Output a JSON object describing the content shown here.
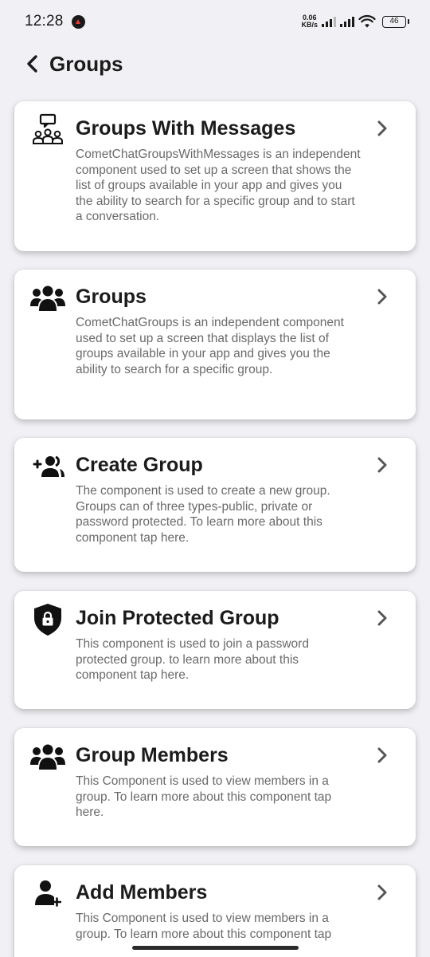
{
  "status": {
    "time": "12:28",
    "net_speed_value": "0.06",
    "net_speed_unit": "KB/s",
    "battery": "46"
  },
  "header": {
    "title": "Groups",
    "back_icon": "chevron-left-icon"
  },
  "cards": [
    {
      "title": "Groups With Messages",
      "description": "CometChatGroupsWithMessages is an independent component used to set up a screen that shows the list of groups available in your app and gives you the ability to search for a specific group and to start a conversation.",
      "icon": "groups-with-messages-icon"
    },
    {
      "title": "Groups",
      "description": "CometChatGroups is an independent component used to set up a screen that displays the list of groups available in your app and gives you the ability to search for a specific group.",
      "icon": "groups-icon"
    },
    {
      "title": "Create Group",
      "description": "The component is used to create a new group. Groups can of three types-public, private or password protected. To learn more about this component tap here.",
      "icon": "create-group-icon"
    },
    {
      "title": "Join Protected Group",
      "description": "This component is used to join a password protected group. to learn more about this component tap here.",
      "icon": "shield-lock-icon"
    },
    {
      "title": "Group Members",
      "description": "This Component is used to view members in a group. To learn more about this component tap here.",
      "icon": "group-members-icon"
    },
    {
      "title": "Add Members",
      "description": "This Component is used to view members in a group. To learn more about this component tap",
      "icon": "add-member-icon"
    }
  ]
}
